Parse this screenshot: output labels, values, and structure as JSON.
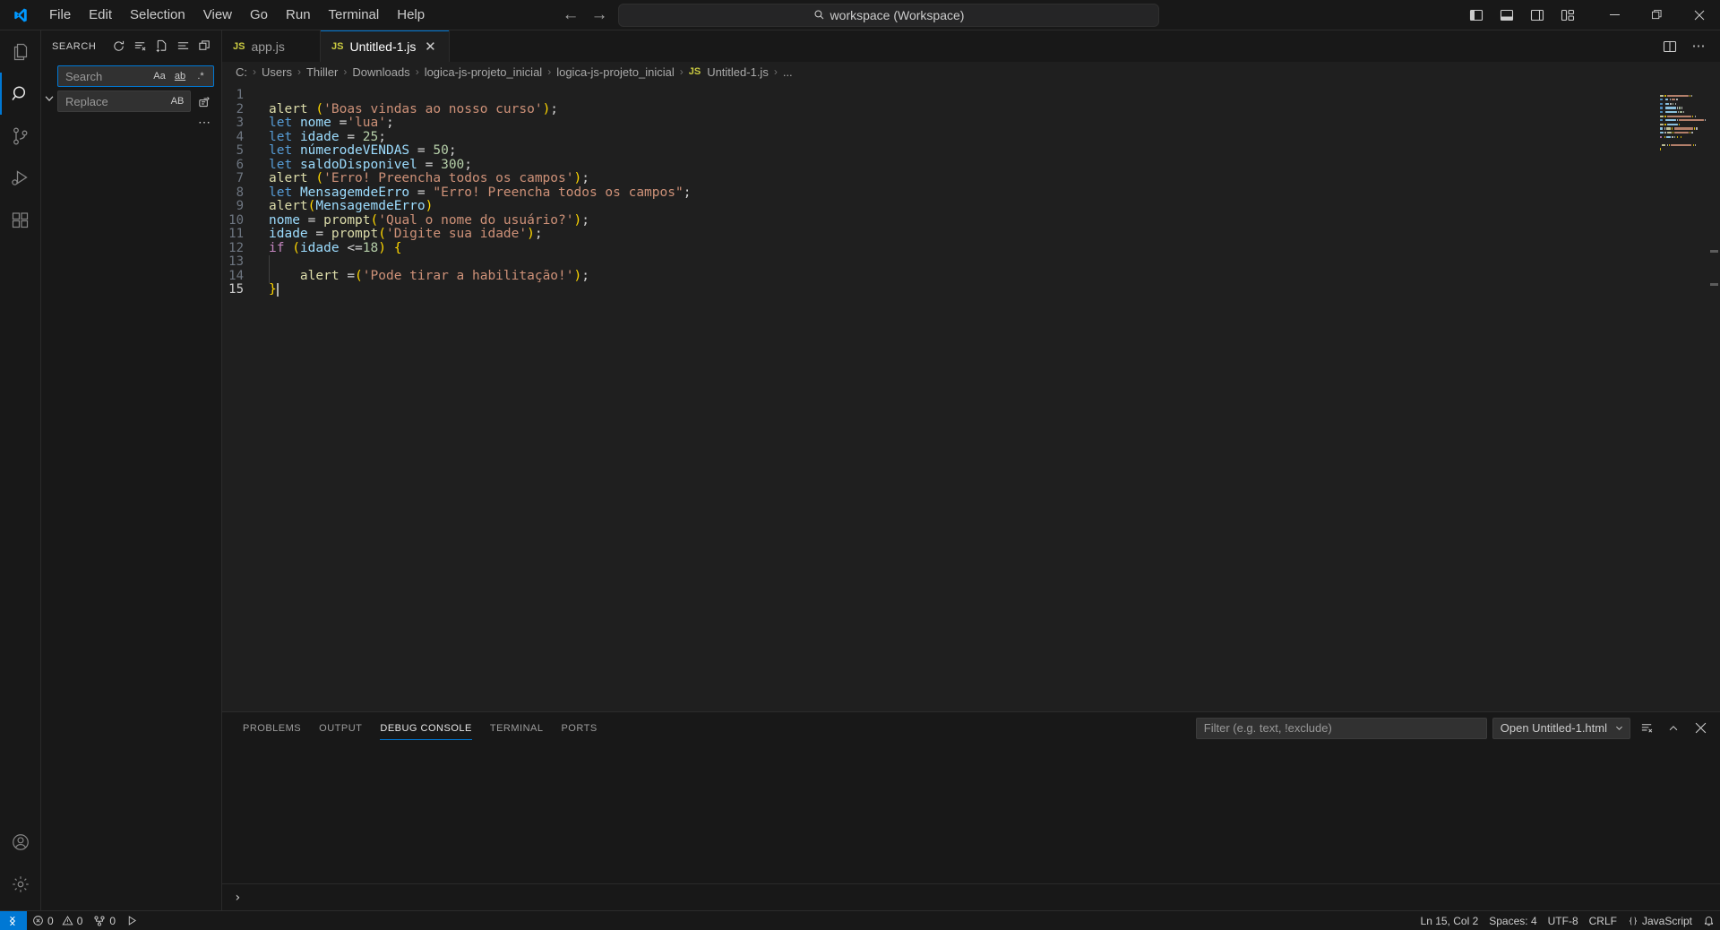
{
  "titlebar": {
    "menus": [
      "File",
      "Edit",
      "Selection",
      "View",
      "Go",
      "Run",
      "Terminal",
      "Help"
    ],
    "command_center_text": "workspace (Workspace)",
    "back_label": "Go Back",
    "forward_label": "Go Forward",
    "layout_icons": [
      {
        "name": "toggle-primary-sidebar",
        "label": "Toggle Primary Side Bar"
      },
      {
        "name": "toggle-panel",
        "label": "Toggle Panel"
      },
      {
        "name": "toggle-secondary-sidebar",
        "label": "Toggle Secondary Side Bar"
      },
      {
        "name": "customize-layout",
        "label": "Customize Layout"
      }
    ],
    "window_controls": {
      "minimize": "—",
      "maximize": "❐",
      "close": "✕"
    }
  },
  "activitybar": {
    "items": [
      {
        "name": "explorer",
        "label": "Explorer",
        "active": false
      },
      {
        "name": "search",
        "label": "Search",
        "active": true
      },
      {
        "name": "source-control",
        "label": "Source Control",
        "active": false
      },
      {
        "name": "run-and-debug",
        "label": "Run and Debug",
        "active": false
      },
      {
        "name": "extensions",
        "label": "Extensions",
        "active": false
      }
    ],
    "bottom": [
      {
        "name": "accounts",
        "label": "Accounts"
      },
      {
        "name": "manage",
        "label": "Manage"
      }
    ]
  },
  "sidebar": {
    "title": "SEARCH",
    "actions": [
      {
        "name": "refresh",
        "label": "Refresh"
      },
      {
        "name": "clear-search-results",
        "label": "Clear Search Results"
      },
      {
        "name": "open-new-search-editor",
        "label": "Open New Search Editor"
      },
      {
        "name": "view-as-tree",
        "label": "View as Tree"
      },
      {
        "name": "collapse-all",
        "label": "Collapse All"
      }
    ],
    "search": {
      "placeholder": "Search",
      "value": "",
      "options": [
        {
          "name": "match-case",
          "label": "Aa"
        },
        {
          "name": "match-whole-word",
          "label": "ab"
        },
        {
          "name": "use-regular-expression",
          "label": ".*"
        }
      ]
    },
    "replace": {
      "placeholder": "Replace",
      "value": "",
      "options": [
        {
          "name": "preserve-case",
          "label": "AB"
        }
      ],
      "replace_all_label": "Replace All"
    },
    "toggle_details_label": "Toggle Search Details"
  },
  "editor": {
    "tabs": [
      {
        "name": "app.js",
        "label": "app.js",
        "badge": "JS",
        "active": false,
        "closable": false
      },
      {
        "name": "untitled-1.js",
        "label": "Untitled-1.js",
        "badge": "JS",
        "active": true,
        "closable": true,
        "close_label": "✕"
      }
    ],
    "tab_actions": [
      {
        "name": "split-editor-right",
        "label": "Split Editor Right"
      },
      {
        "name": "more-actions",
        "label": "More Actions..."
      }
    ],
    "breadcrumbs": [
      "C:",
      "Users",
      "Thiller",
      "Downloads",
      "logica-js-projeto_inicial",
      "logica-js-projeto_inicial",
      "Untitled-1.js",
      "..."
    ],
    "breadcrumb_file_badge": "JS",
    "breadcrumb_separator": "›",
    "code_lines": [
      {
        "n": 1,
        "tokens": []
      },
      {
        "n": 2,
        "tokens": [
          {
            "t": "alert ",
            "c": "t-fn"
          },
          {
            "t": "(",
            "c": "t-par"
          },
          {
            "t": "'Boas vindas ao nosso curso'",
            "c": "t-str"
          },
          {
            "t": ")",
            "c": "t-par"
          },
          {
            "t": ";",
            "c": "t-plain"
          }
        ]
      },
      {
        "n": 3,
        "tokens": [
          {
            "t": "let",
            "c": "t-kw"
          },
          {
            "t": " ",
            "c": "t-plain"
          },
          {
            "t": "nome",
            "c": "t-var"
          },
          {
            "t": " =",
            "c": "t-plain"
          },
          {
            "t": "'lua'",
            "c": "t-str"
          },
          {
            "t": ";",
            "c": "t-plain"
          }
        ]
      },
      {
        "n": 4,
        "tokens": [
          {
            "t": "let",
            "c": "t-kw"
          },
          {
            "t": " ",
            "c": "t-plain"
          },
          {
            "t": "idade",
            "c": "t-var"
          },
          {
            "t": " = ",
            "c": "t-plain"
          },
          {
            "t": "25",
            "c": "t-num"
          },
          {
            "t": ";",
            "c": "t-plain"
          }
        ]
      },
      {
        "n": 5,
        "tokens": [
          {
            "t": "let",
            "c": "t-kw"
          },
          {
            "t": " ",
            "c": "t-plain"
          },
          {
            "t": "númerodeVENDAS",
            "c": "t-var"
          },
          {
            "t": " = ",
            "c": "t-plain"
          },
          {
            "t": "50",
            "c": "t-num"
          },
          {
            "t": ";",
            "c": "t-plain"
          }
        ]
      },
      {
        "n": 6,
        "tokens": [
          {
            "t": "let",
            "c": "t-kw"
          },
          {
            "t": " ",
            "c": "t-plain"
          },
          {
            "t": "saldoDisponivel",
            "c": "t-var"
          },
          {
            "t": " = ",
            "c": "t-plain"
          },
          {
            "t": "300",
            "c": "t-num"
          },
          {
            "t": ";",
            "c": "t-plain"
          }
        ]
      },
      {
        "n": 7,
        "tokens": [
          {
            "t": "alert ",
            "c": "t-fn"
          },
          {
            "t": "(",
            "c": "t-par"
          },
          {
            "t": "'Erro! Preencha todos os campos'",
            "c": "t-str"
          },
          {
            "t": ")",
            "c": "t-par"
          },
          {
            "t": ";",
            "c": "t-plain"
          }
        ]
      },
      {
        "n": 8,
        "tokens": [
          {
            "t": "let",
            "c": "t-kw"
          },
          {
            "t": " ",
            "c": "t-plain"
          },
          {
            "t": "MensagemdeErro",
            "c": "t-var"
          },
          {
            "t": " = ",
            "c": "t-plain"
          },
          {
            "t": "\"Erro! Preencha todos os campos\"",
            "c": "t-str"
          },
          {
            "t": ";",
            "c": "t-plain"
          }
        ]
      },
      {
        "n": 9,
        "tokens": [
          {
            "t": "alert",
            "c": "t-fn"
          },
          {
            "t": "(",
            "c": "t-par"
          },
          {
            "t": "MensagemdeErro",
            "c": "t-var"
          },
          {
            "t": ")",
            "c": "t-par"
          }
        ]
      },
      {
        "n": 10,
        "tokens": [
          {
            "t": "nome",
            "c": "t-var"
          },
          {
            "t": " = ",
            "c": "t-plain"
          },
          {
            "t": "prompt",
            "c": "t-fn"
          },
          {
            "t": "(",
            "c": "t-par"
          },
          {
            "t": "'Qual o nome do usuário?'",
            "c": "t-str"
          },
          {
            "t": ")",
            "c": "t-par"
          },
          {
            "t": ";",
            "c": "t-plain"
          }
        ]
      },
      {
        "n": 11,
        "tokens": [
          {
            "t": "idade",
            "c": "t-var"
          },
          {
            "t": " = ",
            "c": "t-plain"
          },
          {
            "t": "prompt",
            "c": "t-fn"
          },
          {
            "t": "(",
            "c": "t-par"
          },
          {
            "t": "'Digite sua idade'",
            "c": "t-str"
          },
          {
            "t": ")",
            "c": "t-par"
          },
          {
            "t": ";",
            "c": "t-plain"
          }
        ]
      },
      {
        "n": 12,
        "tokens": [
          {
            "t": "if",
            "c": "t-kw2"
          },
          {
            "t": " ",
            "c": "t-plain"
          },
          {
            "t": "(",
            "c": "t-par"
          },
          {
            "t": "idade",
            "c": "t-var"
          },
          {
            "t": " <=",
            "c": "t-plain"
          },
          {
            "t": "18",
            "c": "t-num"
          },
          {
            "t": ")",
            "c": "t-par"
          },
          {
            "t": " ",
            "c": "t-plain"
          },
          {
            "t": "{",
            "c": "t-par"
          }
        ]
      },
      {
        "n": 13,
        "tokens": []
      },
      {
        "n": 14,
        "tokens": [
          {
            "t": "    ",
            "c": "t-plain"
          },
          {
            "t": "alert ",
            "c": "t-fn"
          },
          {
            "t": "=",
            "c": "t-plain"
          },
          {
            "t": "(",
            "c": "t-par"
          },
          {
            "t": "'Pode tirar a habilitação!'",
            "c": "t-str"
          },
          {
            "t": ")",
            "c": "t-par"
          },
          {
            "t": ";",
            "c": "t-plain"
          }
        ]
      },
      {
        "n": 15,
        "tokens": [
          {
            "t": "}",
            "c": "t-par"
          }
        ]
      }
    ],
    "current_line": 15
  },
  "panel": {
    "tabs": [
      {
        "name": "problems",
        "label": "PROBLEMS",
        "active": false
      },
      {
        "name": "output",
        "label": "OUTPUT",
        "active": false
      },
      {
        "name": "debug-console",
        "label": "DEBUG CONSOLE",
        "active": true
      },
      {
        "name": "terminal",
        "label": "TERMINAL",
        "active": false
      },
      {
        "name": "ports",
        "label": "PORTS",
        "active": false
      }
    ],
    "filter_placeholder": "Filter (e.g. text, !exclude)",
    "filter_value": "",
    "launch_config": "Open Untitled-1.html",
    "actions": [
      {
        "name": "clear-console",
        "label": "Clear Console"
      },
      {
        "name": "maximize-panel-size",
        "label": "Maximize Panel Size"
      },
      {
        "name": "close-panel",
        "label": "Close Panel"
      }
    ],
    "console_prompt": "›",
    "console_content": ""
  },
  "statusbar": {
    "remote_label": "Open a Remote Window",
    "left_items": [
      {
        "name": "problems-errors",
        "icon": "error-icon",
        "label": "0"
      },
      {
        "name": "problems-warnings",
        "icon": "warning-icon",
        "label": "0"
      },
      {
        "name": "ports-forwarded",
        "icon": "ports-icon",
        "label": "0"
      },
      {
        "name": "run-code",
        "icon": "play-icon",
        "label": ""
      }
    ],
    "right_items": [
      {
        "name": "editor-position",
        "label": "Ln 15, Col 2"
      },
      {
        "name": "editor-indentation",
        "label": "Spaces: 4"
      },
      {
        "name": "editor-encoding",
        "label": "UTF-8"
      },
      {
        "name": "editor-eol",
        "label": "CRLF"
      },
      {
        "name": "editor-language",
        "label": "JavaScript"
      }
    ],
    "language_icon": "braces-icon"
  },
  "colors": {
    "accent": "#0078d4",
    "background": "#1f1f1f",
    "chrome": "#181818",
    "js_badge": "#cbcb41"
  }
}
